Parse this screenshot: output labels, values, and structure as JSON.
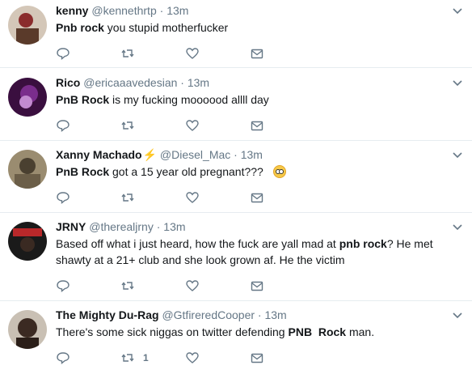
{
  "tweets": [
    {
      "name": "kenny",
      "handle": "@kennethrtp",
      "sep": "·",
      "time": "13m",
      "text_html": "<b>Pnb rock</b> you stupid motherfucker",
      "retweets": "",
      "avatar_colors": [
        "#8a2c2c",
        "#d4c7b8"
      ]
    },
    {
      "name": "Rico",
      "handle": "@ericaaavedesian",
      "sep": "·",
      "time": "13m",
      "text_html": "<b>PnB Rock</b> is my fucking moooood allll day",
      "retweets": "",
      "avatar_colors": [
        "#7a2d8c",
        "#3a0f3f"
      ]
    },
    {
      "name": "Xanny Machado",
      "badge": "⚡",
      "handle": "@Diesel_Mac",
      "sep": "·",
      "time": "13m",
      "text_html": "<b>PnB Rock</b> got a 15 year old pregnant???",
      "has_emoji": true,
      "emoji": "flushed-face",
      "retweets": "",
      "avatar_colors": [
        "#9a8c70",
        "#4a4030"
      ]
    },
    {
      "name": "JRNY",
      "handle": "@therealjrny",
      "sep": "·",
      "time": "13m",
      "text_html": "Based off what i just heard, how the fuck are yall mad at <b>pnb rock</b>? He met shawty at a 21+ club and she look grown af. He the victim",
      "retweets": "",
      "avatar_colors": [
        "#b8282a",
        "#1a1a1a"
      ]
    },
    {
      "name": "The Mighty Du-Rag",
      "handle": "@GtfireredCooper",
      "sep": "·",
      "time": "13m",
      "text_html": "There's some sick niggas on twitter defending <b>PNB</b>  <b>Rock</b> man.",
      "retweets": "1",
      "avatar_colors": [
        "#3b2a22",
        "#c9c0b4"
      ]
    }
  ]
}
